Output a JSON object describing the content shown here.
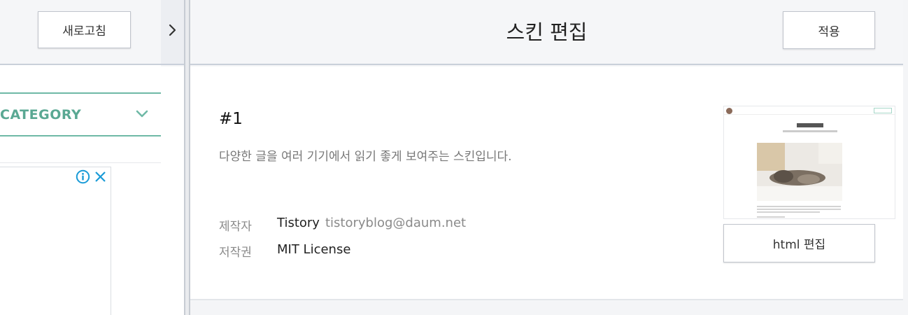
{
  "left_panel": {
    "refresh_label": "새로고침",
    "category_label": "CATEGORY",
    "accent_color": "#5aa893",
    "icons": [
      "chevron-down-icon",
      "info-icon",
      "close-icon"
    ]
  },
  "collapse_icon": "chevron-right-icon",
  "editor": {
    "title": "스킨 편집",
    "apply_label": "적용"
  },
  "skin": {
    "number": "#1",
    "description": "다양한 글을 여러 기기에서 읽기 좋게 보여주는 스킨입니다.",
    "author_label": "제작자",
    "author_name": "Tistory",
    "author_email": "tistoryblog@daum.net",
    "license_label": "저작권",
    "license_value": "MIT License",
    "html_edit_label": "html 편집"
  }
}
